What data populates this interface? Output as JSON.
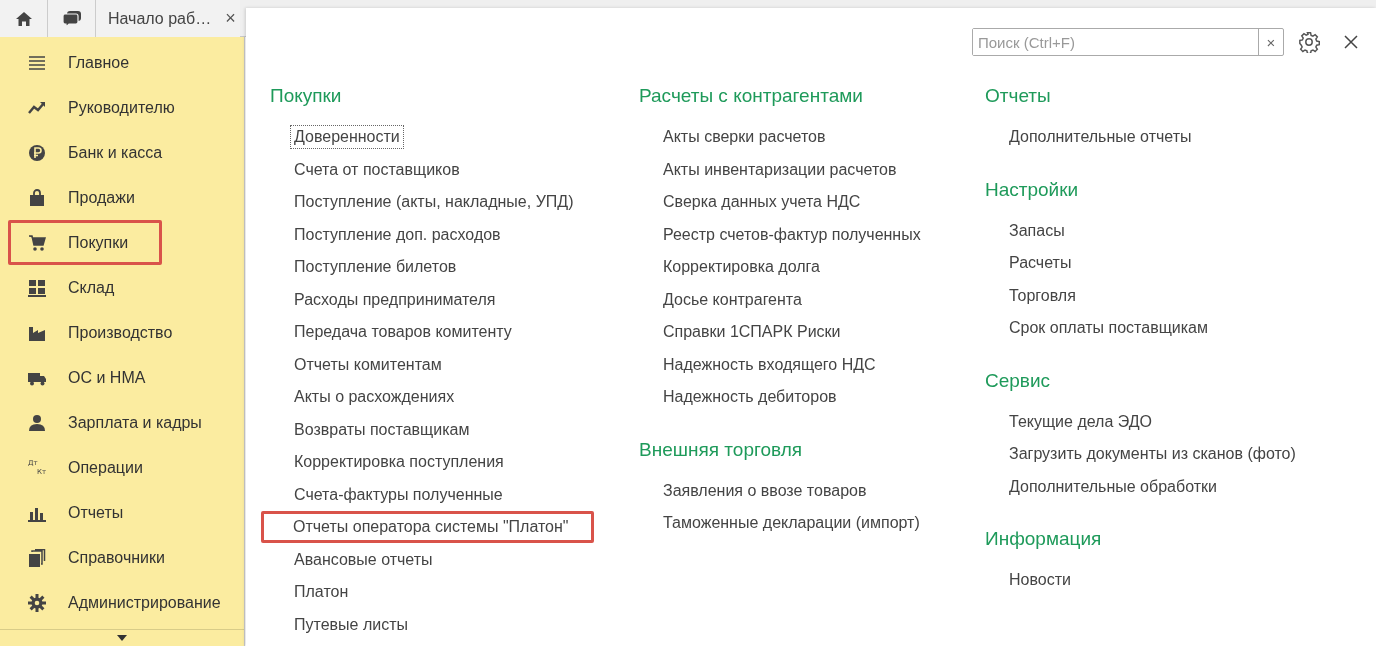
{
  "top_bar": {
    "tab": {
      "label": "Начало раб…",
      "close": "×"
    }
  },
  "sidebar": {
    "items": [
      {
        "label": "Главное",
        "highlighted": false
      },
      {
        "label": "Руководителю",
        "highlighted": false
      },
      {
        "label": "Банк и касса",
        "highlighted": false
      },
      {
        "label": "Продажи",
        "highlighted": false
      },
      {
        "label": "Покупки",
        "highlighted": true
      },
      {
        "label": "Склад",
        "highlighted": false
      },
      {
        "label": "Производство",
        "highlighted": false
      },
      {
        "label": "ОС и НМА",
        "highlighted": false
      },
      {
        "label": "Зарплата и кадры",
        "highlighted": false
      },
      {
        "label": "Операции",
        "icon_text": [
          "Дт",
          "Кт"
        ],
        "highlighted": false
      },
      {
        "label": "Отчеты",
        "highlighted": false
      },
      {
        "label": "Справочники",
        "highlighted": false
      },
      {
        "label": "Администрирование",
        "highlighted": false
      }
    ]
  },
  "search": {
    "placeholder": "Поиск (Ctrl+F)",
    "clear": "×"
  },
  "columns": [
    [
      {
        "title": "Покупки",
        "links": [
          {
            "label": "Доверенности",
            "focused": true,
            "highlighted": false
          },
          {
            "label": "Счета от поставщиков",
            "focused": false,
            "highlighted": false
          },
          {
            "label": "Поступление (акты, накладные, УПД)",
            "focused": false,
            "highlighted": false
          },
          {
            "label": "Поступление доп. расходов",
            "focused": false,
            "highlighted": false
          },
          {
            "label": "Поступление билетов",
            "focused": false,
            "highlighted": false
          },
          {
            "label": "Расходы предпринимателя",
            "focused": false,
            "highlighted": false
          },
          {
            "label": "Передача товаров комитенту",
            "focused": false,
            "highlighted": false
          },
          {
            "label": "Отчеты комитентам",
            "focused": false,
            "highlighted": false
          },
          {
            "label": "Акты о расхождениях",
            "focused": false,
            "highlighted": false
          },
          {
            "label": "Возвраты поставщикам",
            "focused": false,
            "highlighted": false
          },
          {
            "label": "Корректировка поступления",
            "focused": false,
            "highlighted": false
          },
          {
            "label": "Счета-фактуры полученные",
            "focused": false,
            "highlighted": false
          },
          {
            "label": "Отчеты оператора системы \"Платон\"",
            "focused": false,
            "highlighted": true
          },
          {
            "label": "Авансовые отчеты",
            "focused": false,
            "highlighted": false
          },
          {
            "label": "Платон",
            "focused": false,
            "highlighted": false
          },
          {
            "label": "Путевые листы",
            "focused": false,
            "highlighted": false
          }
        ]
      }
    ],
    [
      {
        "title": "Расчеты с контрагентами",
        "links": [
          {
            "label": "Акты сверки расчетов",
            "focused": false,
            "highlighted": false
          },
          {
            "label": "Акты инвентаризации расчетов",
            "focused": false,
            "highlighted": false
          },
          {
            "label": "Сверка данных учета НДС",
            "focused": false,
            "highlighted": false
          },
          {
            "label": "Реестр счетов-фактур полученных",
            "focused": false,
            "highlighted": false
          },
          {
            "label": "Корректировка долга",
            "focused": false,
            "highlighted": false
          },
          {
            "label": "Досье контрагента",
            "focused": false,
            "highlighted": false
          },
          {
            "label": "Справки 1СПАРК Риски",
            "focused": false,
            "highlighted": false
          },
          {
            "label": "Надежность входящего НДС",
            "focused": false,
            "highlighted": false
          },
          {
            "label": "Надежность дебиторов",
            "focused": false,
            "highlighted": false
          }
        ]
      },
      {
        "title": "Внешняя торговля",
        "links": [
          {
            "label": "Заявления о ввозе товаров",
            "focused": false,
            "highlighted": false
          },
          {
            "label": "Таможенные декларации (импорт)",
            "focused": false,
            "highlighted": false
          }
        ]
      }
    ],
    [
      {
        "title": "Отчеты",
        "links": [
          {
            "label": "Дополнительные отчеты",
            "focused": false,
            "highlighted": false
          }
        ]
      },
      {
        "title": "Настройки",
        "links": [
          {
            "label": "Запасы",
            "focused": false,
            "highlighted": false
          },
          {
            "label": "Расчеты",
            "focused": false,
            "highlighted": false
          },
          {
            "label": "Торговля",
            "focused": false,
            "highlighted": false
          },
          {
            "label": "Срок оплаты поставщикам",
            "focused": false,
            "highlighted": false
          }
        ]
      },
      {
        "title": "Сервис",
        "links": [
          {
            "label": "Текущие дела ЭДО",
            "focused": false,
            "highlighted": false
          },
          {
            "label": "Загрузить документы из сканов (фото)",
            "focused": false,
            "highlighted": false
          },
          {
            "label": "Дополнительные обработки",
            "focused": false,
            "highlighted": false
          }
        ]
      },
      {
        "title": "Информация",
        "links": [
          {
            "label": "Новости",
            "focused": false,
            "highlighted": false
          }
        ]
      }
    ]
  ]
}
